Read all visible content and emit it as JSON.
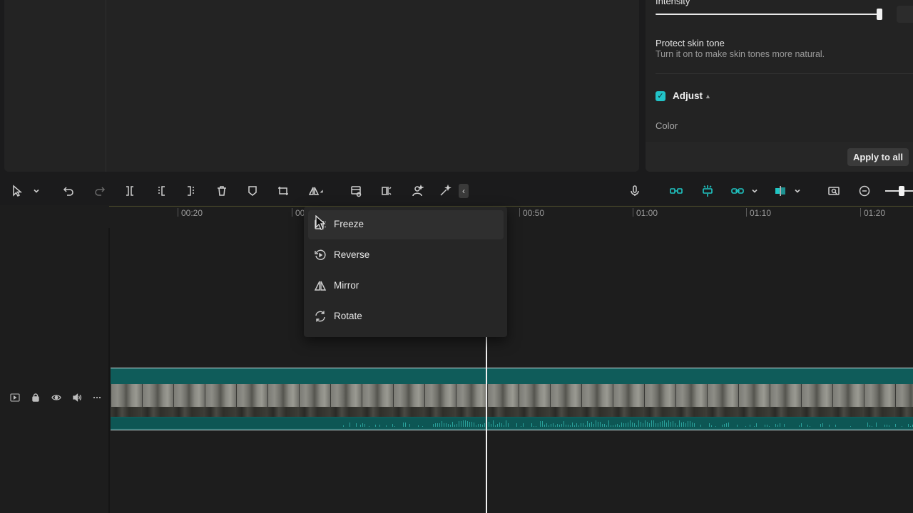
{
  "properties": {
    "intensity_label": "Intensity",
    "protect_skin_title": "Protect skin tone",
    "protect_skin_desc": "Turn it on to make skin tones more natural.",
    "adjust_label": "Adjust",
    "color_label": "Color",
    "apply_all_label": "Apply to all"
  },
  "ruler": {
    "ticks": [
      "00:20",
      "00",
      "00:50",
      "01:00",
      "01:10",
      "01:20"
    ]
  },
  "menu": {
    "items": [
      {
        "label": "Freeze",
        "icon": "freeze-icon"
      },
      {
        "label": "Reverse",
        "icon": "reverse-icon"
      },
      {
        "label": "Mirror",
        "icon": "mirror-icon"
      },
      {
        "label": "Rotate",
        "icon": "rotate-icon"
      }
    ]
  },
  "toolbar": {
    "icons": [
      "select-arrow-icon",
      "undo-icon",
      "redo-icon",
      "split-icon",
      "split-left-icon",
      "split-right-icon",
      "delete-icon",
      "marker-icon",
      "crop-icon",
      "transform-icon",
      "image-settings-icon",
      "freeze-frame-icon",
      "person-ai-icon",
      "magic-wand-icon",
      "microphone-icon",
      "main-track-magnet-icon",
      "auto-snap-icon",
      "link-icon",
      "preview-axis-icon",
      "zoom-fit-icon",
      "zoom-out-icon"
    ]
  },
  "track": {
    "controls": [
      "track-toggle-icon",
      "lock-icon",
      "eye-icon",
      "speaker-icon",
      "more-icon"
    ]
  },
  "colors": {
    "accent": "#1fc6c4",
    "clip": "#0f5c5a",
    "panel": "#232323"
  }
}
